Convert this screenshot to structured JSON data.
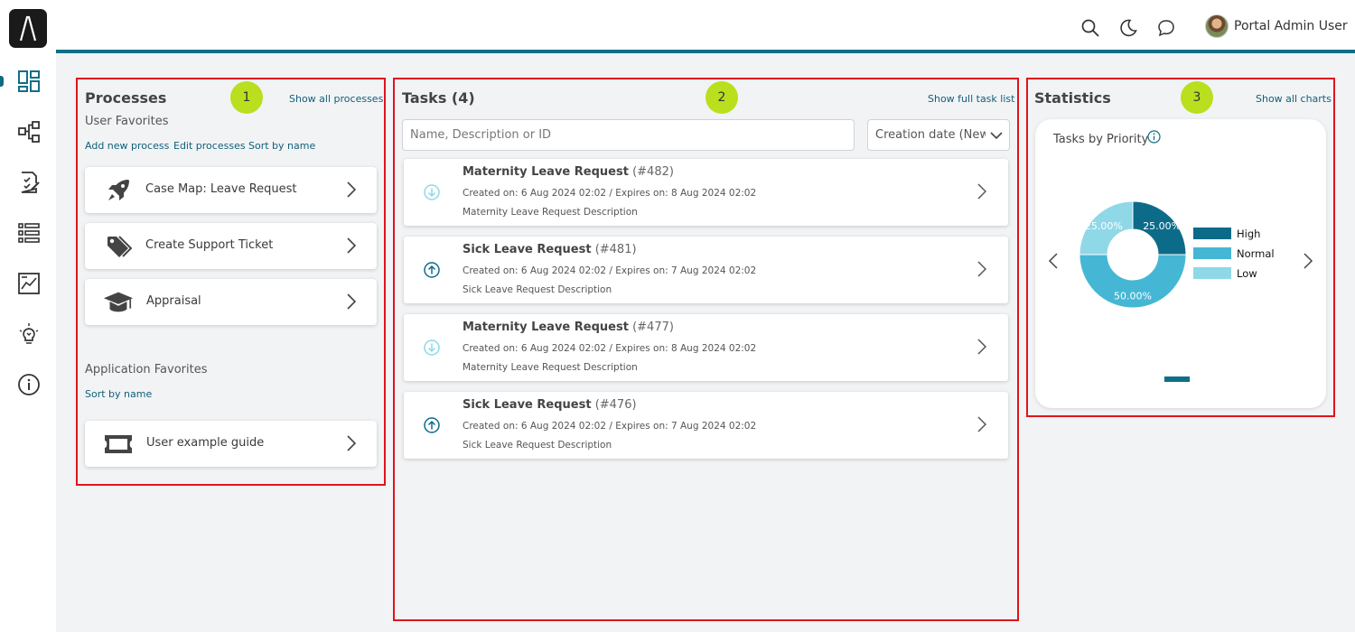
{
  "header": {
    "user_name": "Portal Admin User"
  },
  "processes": {
    "title": "Processes",
    "show_all": "Show all processes",
    "badge": "1",
    "user_favorites_label": "User Favorites",
    "actions": [
      "Add new process",
      "Edit processes",
      "Sort by name"
    ],
    "items": [
      {
        "name": "Case Map: Leave Request",
        "icon": "rocket-icon"
      },
      {
        "name": "Create Support Ticket",
        "icon": "tags-icon"
      },
      {
        "name": "Appraisal",
        "icon": "graduation-cap-icon"
      }
    ],
    "app_favorites_label": "Application Favorites",
    "app_sort": "Sort by name",
    "app_items": [
      {
        "name": "User example guide",
        "icon": "ticket-icon"
      }
    ]
  },
  "tasks": {
    "title": "Tasks (4)",
    "show_full": "Show full task list",
    "badge": "2",
    "search_placeholder": "Name, Description or ID",
    "sort_value": "Creation date (Newest first)",
    "items": [
      {
        "title": "Maternity Leave Request",
        "id": "(#482)",
        "dates": "Created on: 6 Aug 2024 02:02 / Expires on: 8 Aug 2024 02:02",
        "desc": "Maternity Leave Request Description",
        "priority": "low"
      },
      {
        "title": "Sick Leave Request",
        "id": "(#481)",
        "dates": "Created on: 6 Aug 2024 02:02 / Expires on: 7 Aug 2024 02:02",
        "desc": "Sick Leave Request Description",
        "priority": "high"
      },
      {
        "title": "Maternity Leave Request",
        "id": "(#477)",
        "dates": "Created on: 6 Aug 2024 02:02 / Expires on: 8 Aug 2024 02:02",
        "desc": "Maternity Leave Request Description",
        "priority": "low"
      },
      {
        "title": "Sick Leave Request",
        "id": "(#476)",
        "dates": "Created on: 6 Aug 2024 02:02 / Expires on: 7 Aug 2024 02:02",
        "desc": "Sick Leave Request Description",
        "priority": "high"
      }
    ]
  },
  "statistics": {
    "title": "Statistics",
    "show_all": "Show all charts",
    "badge": "3"
  },
  "colors": {
    "brand": "#106f86",
    "high": "#0d6b8a",
    "normal": "#45b7d4",
    "low": "#8fd8e8",
    "badge": "#b9df1e",
    "highlight": "#e0141c"
  },
  "chart_data": {
    "type": "pie",
    "title": "Tasks by Priority",
    "labels": [
      "High",
      "Normal",
      "Low"
    ],
    "values": [
      25,
      50,
      25
    ],
    "value_labels": [
      "25.00%",
      "50.00%",
      "25.00%"
    ],
    "colors": [
      "#0d6b8a",
      "#45b7d4",
      "#8fd8e8"
    ],
    "donut": true,
    "legend": "right"
  }
}
